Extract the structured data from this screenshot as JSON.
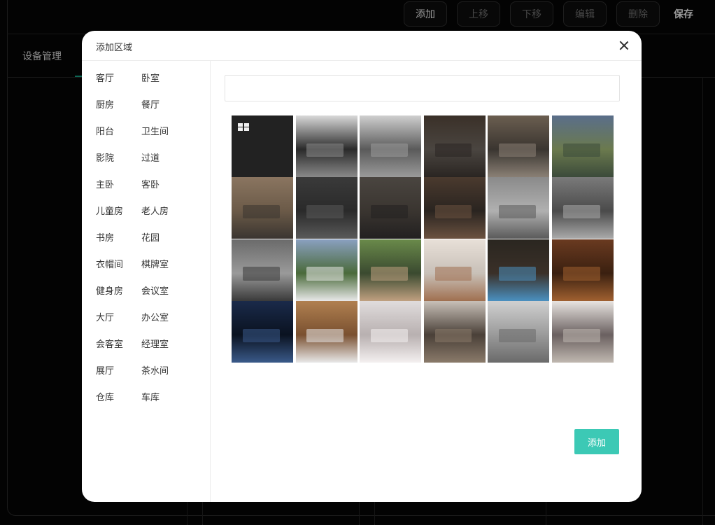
{
  "background": {
    "page_title": "设备管理",
    "toolbar": {
      "add": "添加",
      "move_up": "上移",
      "move_down": "下移",
      "edit": "编辑",
      "delete": "删除",
      "save": "保存"
    }
  },
  "modal": {
    "title": "添加区域",
    "search": {
      "value": "",
      "placeholder": ""
    },
    "add_button": "添加",
    "rooms": [
      "客厅",
      "卧室",
      "厨房",
      "餐厅",
      "阳台",
      "卫生间",
      "影院",
      "过道",
      "主卧",
      "客卧",
      "儿童房",
      "老人房",
      "书房",
      "花园",
      "衣帽间",
      "棋牌室",
      "健身房",
      "会议室",
      "大厅",
      "办公室",
      "会客室",
      "经理室",
      "展厅",
      "茶水间",
      "仓库",
      "车库"
    ],
    "images": [
      {
        "name": "default-grid-tile",
        "palette": [
          "#222222",
          "#222222",
          "#222222"
        ]
      },
      {
        "name": "bedroom-gray",
        "palette": [
          "#d9d9d9",
          "#8a8a8a",
          "#2a2a2a"
        ]
      },
      {
        "name": "bedroom-light",
        "palette": [
          "#cfcfcf",
          "#9a9a9a",
          "#5a5a5a"
        ]
      },
      {
        "name": "kitchen-dark",
        "palette": [
          "#3a3028",
          "#2a2522",
          "#4a4540"
        ]
      },
      {
        "name": "bar-counter",
        "palette": [
          "#6b5e50",
          "#8a8075",
          "#3a3530"
        ]
      },
      {
        "name": "garden-terrace",
        "palette": [
          "#5a6e8a",
          "#3b4a3a",
          "#6b7a4e"
        ]
      },
      {
        "name": "tv-wall",
        "palette": [
          "#8a7560",
          "#3a3530",
          "#6b5a48"
        ]
      },
      {
        "name": "office-dark",
        "palette": [
          "#3a3a3a",
          "#5a5a5a",
          "#2a2a2a"
        ]
      },
      {
        "name": "dark-cabinet",
        "palette": [
          "#4a4540",
          "#222020",
          "#3a3530"
        ]
      },
      {
        "name": "study-library",
        "palette": [
          "#4a3a2e",
          "#6b5240",
          "#2a2420"
        ]
      },
      {
        "name": "bedroom-gray-wall",
        "palette": [
          "#8a8a8a",
          "#5a5a5a",
          "#b0b0b0"
        ]
      },
      {
        "name": "bathroom",
        "palette": [
          "#7a7a7a",
          "#aaaaaa",
          "#4a4a4a"
        ]
      },
      {
        "name": "living-gray",
        "palette": [
          "#6a6a6a",
          "#3a3a3a",
          "#9a9a9a"
        ]
      },
      {
        "name": "villa-exterior",
        "palette": [
          "#8aa0c0",
          "#e8e8e8",
          "#4a6a3a"
        ]
      },
      {
        "name": "sunroom",
        "palette": [
          "#6a8a4a",
          "#c0a080",
          "#3a4a30"
        ]
      },
      {
        "name": "staircase",
        "palette": [
          "#e8e0d8",
          "#a07050",
          "#c8c0b8"
        ]
      },
      {
        "name": "home-cinema",
        "palette": [
          "#2a2620",
          "#4a90c0",
          "#3a3028"
        ]
      },
      {
        "name": "wine-cellar",
        "palette": [
          "#6a3a20",
          "#a06030",
          "#3a2010"
        ]
      },
      {
        "name": "server-cabinet",
        "palette": [
          "#1a2a4a",
          "#3a5a8a",
          "#0a1220"
        ]
      },
      {
        "name": "laundry-room",
        "palette": [
          "#b08050",
          "#e8e8e8",
          "#7a5030"
        ]
      },
      {
        "name": "white-room",
        "palette": [
          "#e0dcdc",
          "#f4f0f0",
          "#b8b0b0"
        ]
      },
      {
        "name": "dining-lamps",
        "palette": [
          "#c8c0b8",
          "#8a7a6a",
          "#4a4038"
        ]
      },
      {
        "name": "bookshelf-room",
        "palette": [
          "#d0d0d0",
          "#6a6a6a",
          "#9a9a9a"
        ]
      },
      {
        "name": "minimal-stairs",
        "palette": [
          "#e8e4e0",
          "#c0b8b0",
          "#6a6060"
        ]
      }
    ]
  }
}
